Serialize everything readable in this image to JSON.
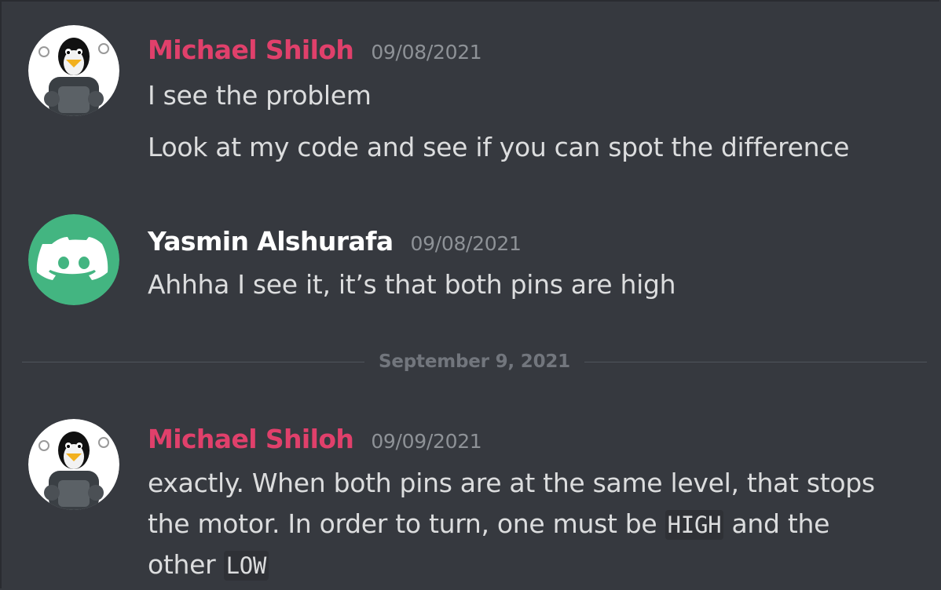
{
  "messages": [
    {
      "author": "Michael Shiloh",
      "timestamp": "09/08/2021",
      "lines": [
        "I see the problem",
        "Look at my code and see if you can spot the difference"
      ]
    },
    {
      "author": "Yasmin Alshurafa",
      "timestamp": "09/08/2021",
      "lines": [
        "Ahhha I see it, it’s that both pins are high"
      ]
    },
    {
      "author": "Michael Shiloh",
      "timestamp": "09/09/2021",
      "line1": "exactly. When both pins are at the same level, that stops",
      "line2_pre": "the motor. In order to turn, one must be ",
      "code_high": "HIGH",
      "line2_post": " and the",
      "line3_pre": "other ",
      "code_low": "LOW"
    }
  ],
  "divider": {
    "label": "September 9, 2021"
  },
  "colors": {
    "background": "#36393f",
    "author_pink": "#e0406b",
    "author_white": "#ffffff",
    "timestamp": "#8e9297",
    "text": "#dcddde",
    "discord_avatar": "#43b581"
  },
  "icons": {
    "avatar_1": "tux-penguin-avatar",
    "avatar_2": "discord-logo-avatar"
  }
}
